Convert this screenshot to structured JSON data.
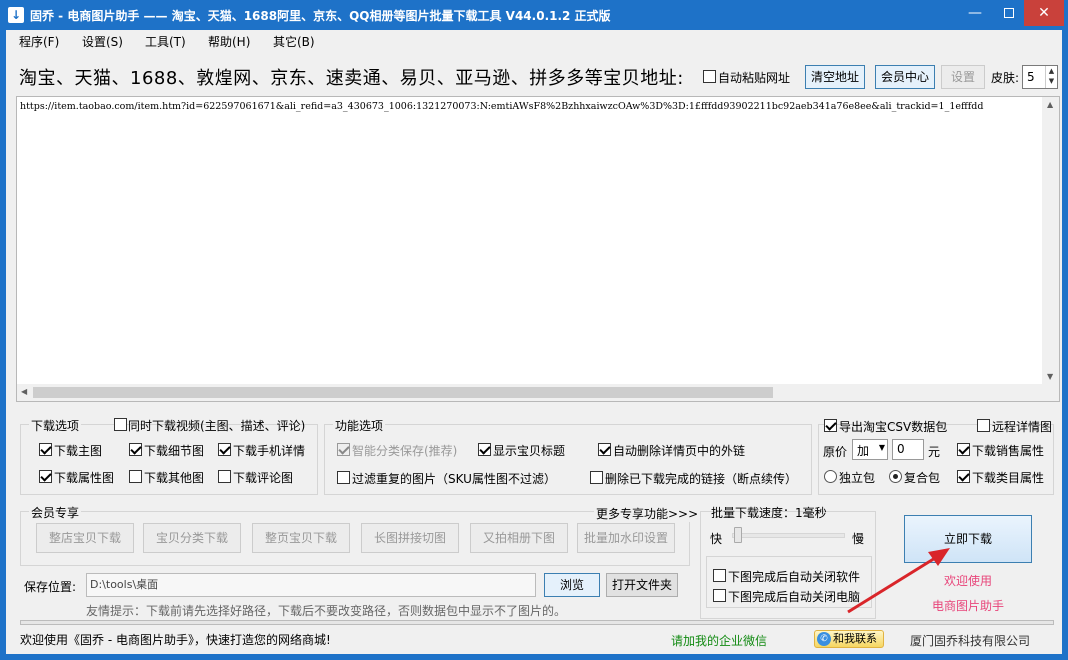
{
  "window": {
    "title": "固乔 - 电商图片助手 —— 淘宝、天猫、1688阿里、京东、QQ相册等图片批量下载工具 V44.0.1.2 正式版",
    "minimize_glyph": "—",
    "close_glyph": "✕"
  },
  "menu": [
    {
      "label": "程序(F)"
    },
    {
      "label": "设置(S)"
    },
    {
      "label": "工具(T)"
    },
    {
      "label": "帮助(H)"
    },
    {
      "label": "其它(B)"
    }
  ],
  "url_section": {
    "label": "淘宝、天猫、1688、敦煌网、京东、速卖通、易贝、亚马逊、拼多多等宝贝地址:",
    "auto_paste_label": "自动粘贴网址",
    "auto_paste_checked": false,
    "clear_button": "清空地址",
    "member_button": "会员中心",
    "settings_button": "设置",
    "skin_label": "皮肤:",
    "skin_value": "5",
    "url_value": "https://item.taobao.com/item.htm?id=622597061671&ali_refid=a3_430673_1006:1321270073:N:emtiAWsF8%2BzhhxaiwzcOAw%3D%3D:1£fffdd93902211bc92aeb341a76e8ee&ali_trackid=1_1efffdd"
  },
  "download_options": {
    "title": "下载选项",
    "video_label": "同时下载视频(主图、描述、评论)",
    "video_checked": false,
    "items": [
      {
        "label": "下载主图",
        "checked": true
      },
      {
        "label": "下载细节图",
        "checked": true
      },
      {
        "label": "下载手机详情",
        "checked": true
      },
      {
        "label": "下载属性图",
        "checked": true
      },
      {
        "label": "下载其他图",
        "checked": false
      },
      {
        "label": "下载评论图",
        "checked": false
      }
    ]
  },
  "function_options": {
    "title": "功能选项",
    "items": [
      {
        "label": "智能分类保存(推荐)",
        "checked": true,
        "disabled": true
      },
      {
        "label": "显示宝贝标题",
        "checked": true,
        "disabled": false
      },
      {
        "label": "自动删除详情页中的外链",
        "checked": true,
        "disabled": false
      },
      {
        "label": "过滤重复的图片（SKU属性图不过滤）",
        "checked": false,
        "disabled": false
      },
      {
        "label": "删除已下载完成的链接（断点续传）",
        "checked": false,
        "disabled": false
      }
    ]
  },
  "export_options": {
    "csv_label": "导出淘宝CSV数据包",
    "csv_checked": true,
    "remote_label": "远程详情图",
    "remote_checked": false,
    "price_label": "原价",
    "price_op": "加",
    "price_value": "0",
    "price_unit": "元",
    "sales_attr_label": "下载销售属性",
    "sales_attr_checked": true,
    "single_label": "独立包",
    "combined_label": "复合包",
    "combined_selected": true,
    "category_attr_label": "下载类目属性",
    "category_attr_checked": true
  },
  "member": {
    "title": "会员专享",
    "more_link": "更多专享功能>>>",
    "buttons": [
      "整店宝贝下载",
      "宝贝分类下载",
      "整页宝贝下载",
      "长图拼接切图",
      "又拍相册下图",
      "批量加水印设置"
    ]
  },
  "speed": {
    "label": "批量下载速度：1毫秒",
    "fast": "快",
    "slow": "慢",
    "level": 0.0
  },
  "after_download": {
    "close_software": "下图完成后自动关闭软件",
    "close_software_checked": false,
    "shutdown": "下图完成后自动关闭电脑",
    "shutdown_checked": false
  },
  "start": {
    "button": "立即下载",
    "welcome_line1": "欢迎使用",
    "welcome_line2": "电商图片助手"
  },
  "save": {
    "label": "保存位置:",
    "path": "D:\\tools\\桌面",
    "browse_button": "浏览",
    "open_folder_button": "打开文件夹",
    "tip": "友情提示：下载前请先选择好路径，下载后不要改变路径，否则数据包中显示不了图片的。"
  },
  "status": {
    "text": "欢迎使用《固乔 - 电商图片助手》，快速打造您的网络商城!",
    "wechat": "请加我的企业微信",
    "contact": "和我联系",
    "company": "厦门固乔科技有限公司"
  },
  "colors": {
    "titlebar": "#1e72c8",
    "close_button": "#c9413b",
    "welcome_pink": "#e8457a",
    "wechat_green": "#128a12",
    "arrow_red": "#d9252a"
  }
}
